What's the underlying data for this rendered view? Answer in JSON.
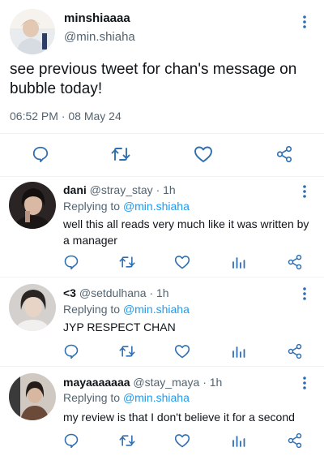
{
  "main_tweet": {
    "display_name": "minshiaaaa",
    "handle": "@min.shiaha",
    "text": "see previous tweet for chan's message on bubble today!",
    "timestamp": "06:52 PM · 08 May 24"
  },
  "replies": [
    {
      "display_name": "dani",
      "handle_time": "@stray_stay · 1h",
      "replying_prefix": "Replying to",
      "replying_to": "@min.shiaha",
      "text": "well this all reads very much like it was written by a manager"
    },
    {
      "display_name": "<3",
      "handle_time": "@setdulhana · 1h",
      "replying_prefix": "Replying to",
      "replying_to": "@min.shiaha",
      "text": "JYP RESPECT CHAN"
    },
    {
      "display_name": "mayaaaaaaa",
      "handle_time": "@stay_maya · 1h",
      "replying_prefix": "Replying to",
      "replying_to": "@min.shiaha",
      "text": "my review is that I don't believe it for a second"
    }
  ],
  "colors": {
    "icon": "#2f6fb0",
    "secondary_text": "#536471",
    "link": "#1d9bf0",
    "divider": "#eff3f4"
  },
  "icons": [
    "reply-icon",
    "retweet-icon",
    "like-icon",
    "analytics-icon",
    "share-icon",
    "more-options-icon"
  ]
}
